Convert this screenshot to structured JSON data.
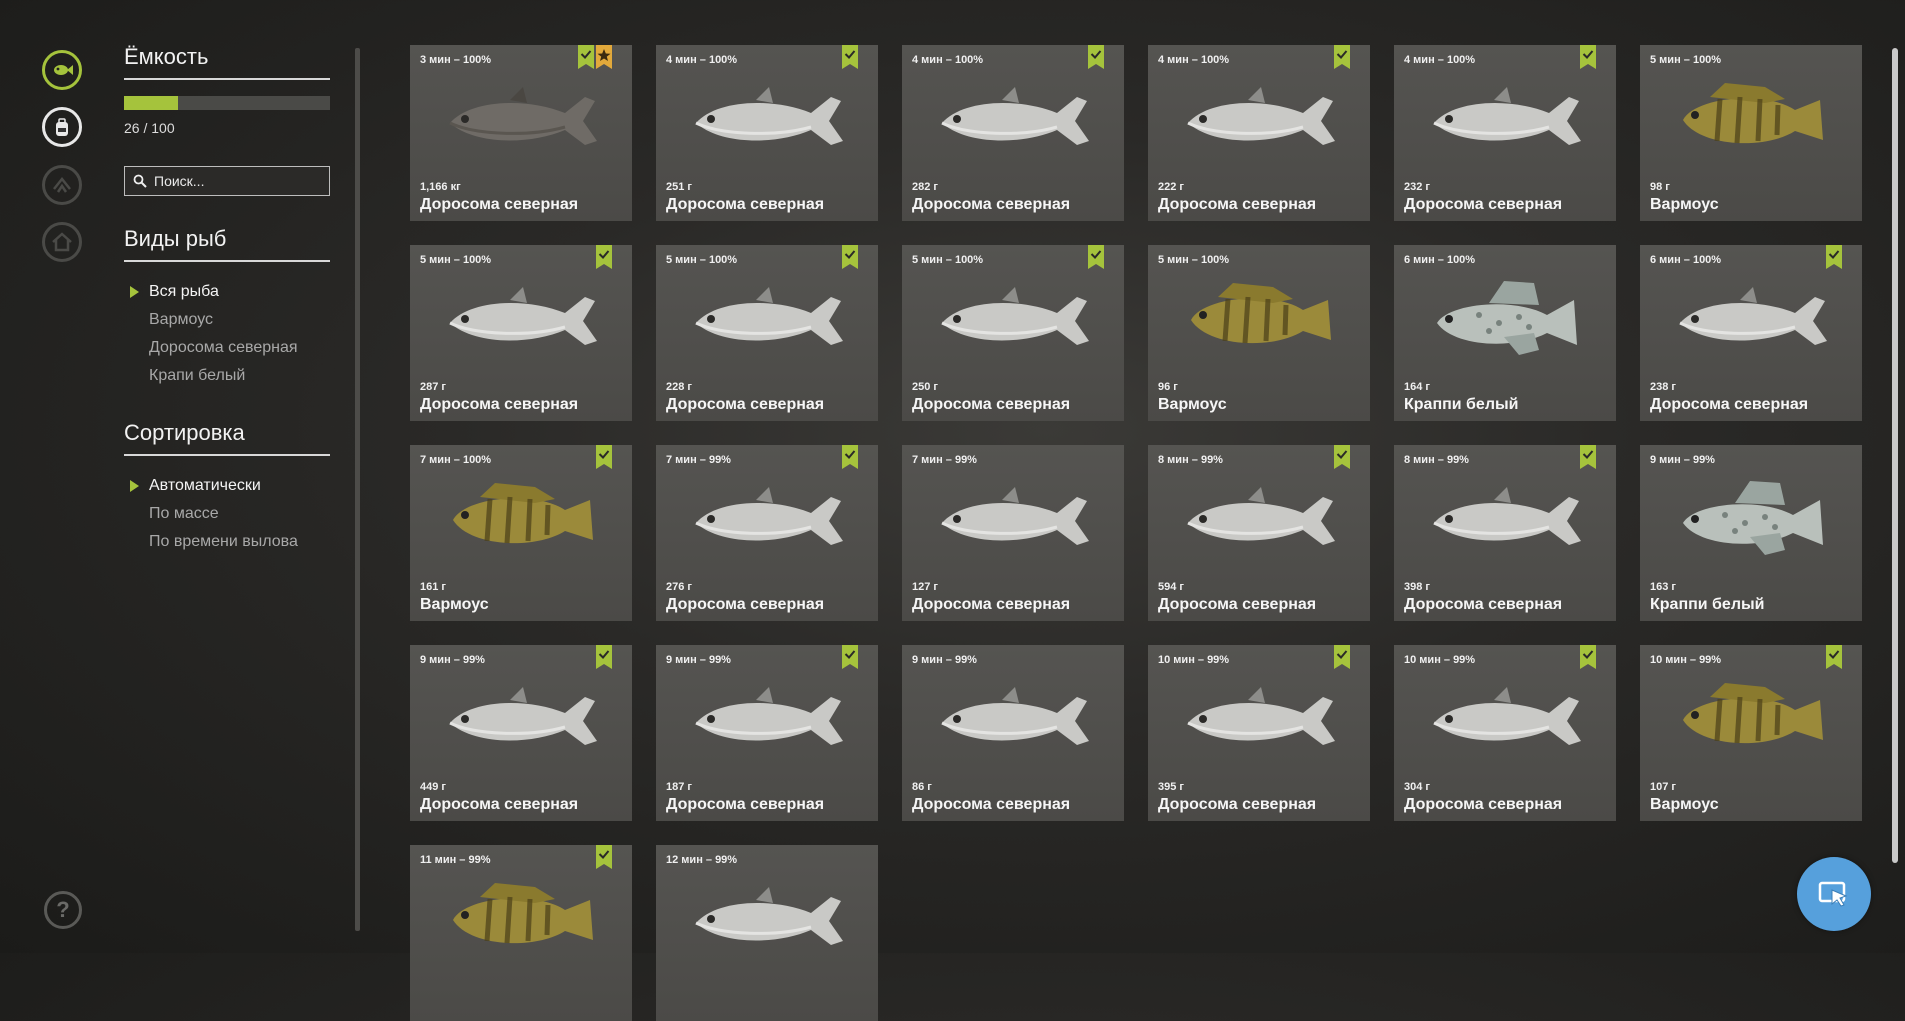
{
  "nav": {
    "icons": [
      "fish-keepnet-icon",
      "backpack-icon",
      "tackle-icon",
      "home-icon"
    ],
    "help_label": "?"
  },
  "capacity": {
    "title": "Ёмкость",
    "current": 26,
    "max": 100,
    "text": "26 / 100"
  },
  "search": {
    "placeholder": "Поиск..."
  },
  "species": {
    "title": "Виды рыб",
    "items": [
      "Вся рыба",
      "Вармоус",
      "Доросома северная",
      "Крапи белый"
    ],
    "selected": 0
  },
  "sorting": {
    "title": "Сортировка",
    "items": [
      "Автоматически",
      "По массе",
      "По времени вылова"
    ],
    "selected": 0
  },
  "colors": {
    "accent": "#a5c33c",
    "card": "#4f4e4b",
    "float_button": "#56a0dc"
  },
  "fish": [
    {
      "time": "3 мин – 100%",
      "weight": "1,166 кг",
      "name": "Доросома северная",
      "kind": "shad-dark",
      "check": true,
      "star": true
    },
    {
      "time": "4 мин – 100%",
      "weight": "251 г",
      "name": "Доросома северная",
      "kind": "shad",
      "check": true
    },
    {
      "time": "4 мин – 100%",
      "weight": "282 г",
      "name": "Доросома северная",
      "kind": "shad",
      "check": true
    },
    {
      "time": "4 мин – 100%",
      "weight": "222 г",
      "name": "Доросома северная",
      "kind": "shad",
      "check": true
    },
    {
      "time": "4 мин – 100%",
      "weight": "232 г",
      "name": "Доросома северная",
      "kind": "shad",
      "check": true
    },
    {
      "time": "5 мин – 100%",
      "weight": "98 г",
      "name": "Вармоус",
      "kind": "warmouth",
      "check": false
    },
    {
      "time": "5 мин – 100%",
      "weight": "287 г",
      "name": "Доросома северная",
      "kind": "shad",
      "check": true
    },
    {
      "time": "5 мин – 100%",
      "weight": "228 г",
      "name": "Доросома северная",
      "kind": "shad",
      "check": true
    },
    {
      "time": "5 мин – 100%",
      "weight": "250 г",
      "name": "Доросома северная",
      "kind": "shad",
      "check": true
    },
    {
      "time": "5 мин – 100%",
      "weight": "96 г",
      "name": "Вармоус",
      "kind": "warmouth",
      "check": false
    },
    {
      "time": "6 мин – 100%",
      "weight": "164 г",
      "name": "Краппи белый",
      "kind": "crappie",
      "check": false
    },
    {
      "time": "6 мин – 100%",
      "weight": "238 г",
      "name": "Доросома северная",
      "kind": "shad",
      "check": true
    },
    {
      "time": "7 мин – 100%",
      "weight": "161 г",
      "name": "Вармоус",
      "kind": "warmouth",
      "check": true
    },
    {
      "time": "7 мин – 99%",
      "weight": "276 г",
      "name": "Доросома северная",
      "kind": "shad",
      "check": true
    },
    {
      "time": "7 мин – 99%",
      "weight": "127 г",
      "name": "Доросома северная",
      "kind": "shad",
      "check": false
    },
    {
      "time": "8 мин – 99%",
      "weight": "594 г",
      "name": "Доросома северная",
      "kind": "shad",
      "check": true
    },
    {
      "time": "8 мин – 99%",
      "weight": "398 г",
      "name": "Доросома северная",
      "kind": "shad",
      "check": true
    },
    {
      "time": "9 мин – 99%",
      "weight": "163 г",
      "name": "Краппи белый",
      "kind": "crappie",
      "check": false
    },
    {
      "time": "9 мин – 99%",
      "weight": "449 г",
      "name": "Доросома северная",
      "kind": "shad",
      "check": true
    },
    {
      "time": "9 мин – 99%",
      "weight": "187 г",
      "name": "Доросома северная",
      "kind": "shad",
      "check": true
    },
    {
      "time": "9 мин – 99%",
      "weight": "86 г",
      "name": "Доросома северная",
      "kind": "shad",
      "check": false
    },
    {
      "time": "10 мин – 99%",
      "weight": "395 г",
      "name": "Доросома северная",
      "kind": "shad",
      "check": true
    },
    {
      "time": "10 мин – 99%",
      "weight": "304 г",
      "name": "Доросома северная",
      "kind": "shad",
      "check": true
    },
    {
      "time": "10 мин – 99%",
      "weight": "107 г",
      "name": "Вармоус",
      "kind": "warmouth",
      "check": true
    },
    {
      "time": "11 мин – 99%",
      "weight": "",
      "name": "",
      "kind": "warmouth",
      "check": true
    },
    {
      "time": "12 мин – 99%",
      "weight": "",
      "name": "",
      "kind": "shad",
      "check": false
    }
  ]
}
